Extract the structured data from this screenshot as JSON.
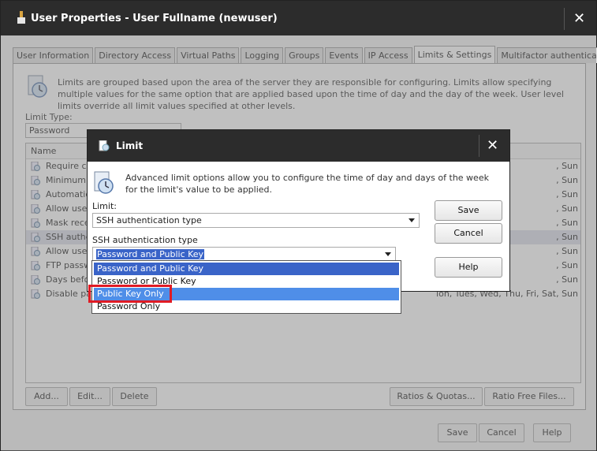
{
  "window": {
    "title": "User Properties - User Fullname (newuser)",
    "close_glyph": "✕"
  },
  "tabs": [
    {
      "label": "User Information"
    },
    {
      "label": "Directory Access"
    },
    {
      "label": "Virtual Paths"
    },
    {
      "label": "Logging"
    },
    {
      "label": "Groups"
    },
    {
      "label": "Events"
    },
    {
      "label": "IP Access"
    },
    {
      "label": "Limits & Settings",
      "active": true
    },
    {
      "label": "Multifactor authentication"
    }
  ],
  "limits_panel": {
    "intro": "Limits are grouped based upon the area of the server they are responsible for configuring. Limits allow specifying multiple values for the same option that are applied based upon the time of day and the day of the week. User level limits override all limit values specified at other levels.",
    "limit_type_label": "Limit Type:",
    "limit_type_value": "Password",
    "grid_header_name": "Name",
    "rows": [
      {
        "name": "Require cor",
        "schedule": ", Sun"
      },
      {
        "name": "Minimum p",
        "schedule": ", Sun"
      },
      {
        "name": "Automatica",
        "schedule": ", Sun"
      },
      {
        "name": "Allow users",
        "schedule": ", Sun"
      },
      {
        "name": "Mask recei",
        "schedule": ", Sun"
      },
      {
        "name": "SSH authen",
        "schedule": ", Sun",
        "selected": true
      },
      {
        "name": "Allow users",
        "schedule": ", Sun"
      },
      {
        "name": "FTP passw",
        "schedule": ", Sun"
      },
      {
        "name": "Days befor",
        "schedule": ", Sun"
      },
      {
        "name": "Disable pas",
        "schedule": "ion, Tues, Wed, Thu, Fri, Sat, Sun"
      }
    ],
    "buttons": {
      "add": "Add...",
      "edit": "Edit...",
      "delete": "Delete",
      "ratios": "Ratios & Quotas...",
      "ratio_free": "Ratio Free Files..."
    }
  },
  "footer": {
    "save": "Save",
    "cancel": "Cancel",
    "help": "Help"
  },
  "limit_dialog": {
    "title": "Limit",
    "description": "Advanced limit options allow you to configure the time of day and days of the week for the limit's value to be applied.",
    "limit_label": "Limit:",
    "limit_value": "SSH authentication type",
    "ssh_label": "SSH authentication type",
    "ssh_value": "Password and Public Key",
    "buttons": {
      "save": "Save",
      "cancel": "Cancel",
      "help": "Help"
    },
    "options": [
      {
        "label": "Password and Public Key",
        "state": "selected"
      },
      {
        "label": "Password or Public Key",
        "state": "normal"
      },
      {
        "label": "Public Key Only",
        "state": "hover"
      },
      {
        "label": "Password Only",
        "state": "normal"
      }
    ]
  },
  "colors": {
    "titlebar": "#2c2c2c",
    "selection": "#3a64c8",
    "hover": "#4f8ee8",
    "highlight": "#e01b24"
  }
}
